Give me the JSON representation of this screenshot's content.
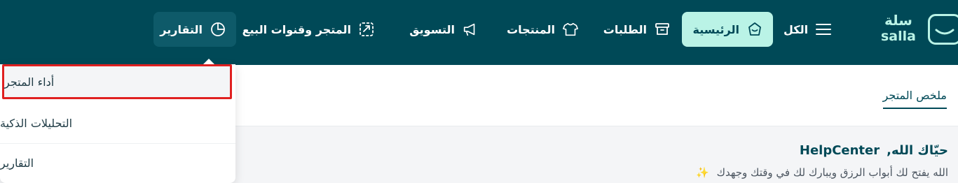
{
  "brand": {
    "arabic": "سلة",
    "latin": "salla"
  },
  "nav": [
    {
      "id": "all",
      "label": "الكل",
      "icon": "menu-icon"
    },
    {
      "id": "home",
      "label": "الرئيسية",
      "icon": "home-icon",
      "active": true
    },
    {
      "id": "orders",
      "label": "الطلبات",
      "icon": "box-icon"
    },
    {
      "id": "products",
      "label": "المنتجات",
      "icon": "shirt-icon"
    },
    {
      "id": "marketing",
      "label": "التسويق",
      "icon": "megaphone-icon"
    },
    {
      "id": "channels",
      "label": "المتجر وقنوات البيع",
      "icon": "store-channels-icon"
    },
    {
      "id": "reports",
      "label": "التقارير",
      "icon": "pie-chart-icon",
      "open": true
    }
  ],
  "tab": {
    "label": "ملخص المتجر"
  },
  "welcome": {
    "greeting": "حيّاك الله,",
    "name": "HelpCenter",
    "subtitle": "الله يفتح لك أبواب الرزق ويبارك لك في وقتك وجهدك",
    "sparkle": "✨"
  },
  "dropdown": {
    "items": [
      {
        "label": "أداء المتجر",
        "highlighted": true
      },
      {
        "label": "التحليلات الذكية"
      },
      {
        "label": "التقارير"
      }
    ]
  },
  "colors": {
    "topbar": "#004957",
    "accent": "#baf3e6",
    "highlight_border": "#e02020"
  }
}
